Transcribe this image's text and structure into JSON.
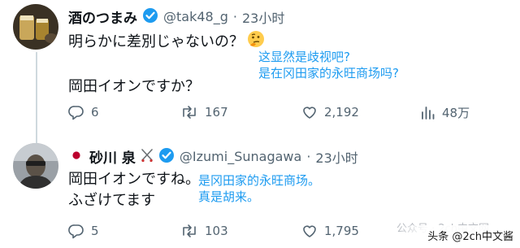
{
  "tweet1": {
    "display_name": "酒のつまみ",
    "handle": "@tak48_g",
    "dot": "·",
    "time": "23小时",
    "line1": "明らかに差別じゃないの？",
    "line2": "岡田イオンですか？",
    "annotation": [
      "这显然是歧视吧?",
      "是在冈田家的永旺商场吗?"
    ],
    "stats": {
      "reply": "6",
      "retweet": "167",
      "like": "2,192",
      "views": "48万"
    }
  },
  "tweet2": {
    "display_name": "砂川 泉",
    "handle": "@Izumi_Sunagawa",
    "dot": "·",
    "time": "23小时",
    "line1": "岡田イオンですね。",
    "line2": "ふざけてます",
    "annotation": [
      "是冈田家的永旺商场。",
      "真是胡来。"
    ],
    "stats": {
      "reply": "5",
      "retweet": "103",
      "like": "1,795"
    }
  },
  "watermark": {
    "text": "公众号 · 2ch中文网",
    "corner": "头条 @2ch中文酱"
  },
  "colors": {
    "accent": "#1d9bf0",
    "muted": "#536471",
    "text": "#0f1419",
    "flag_red": "#bc002d"
  }
}
